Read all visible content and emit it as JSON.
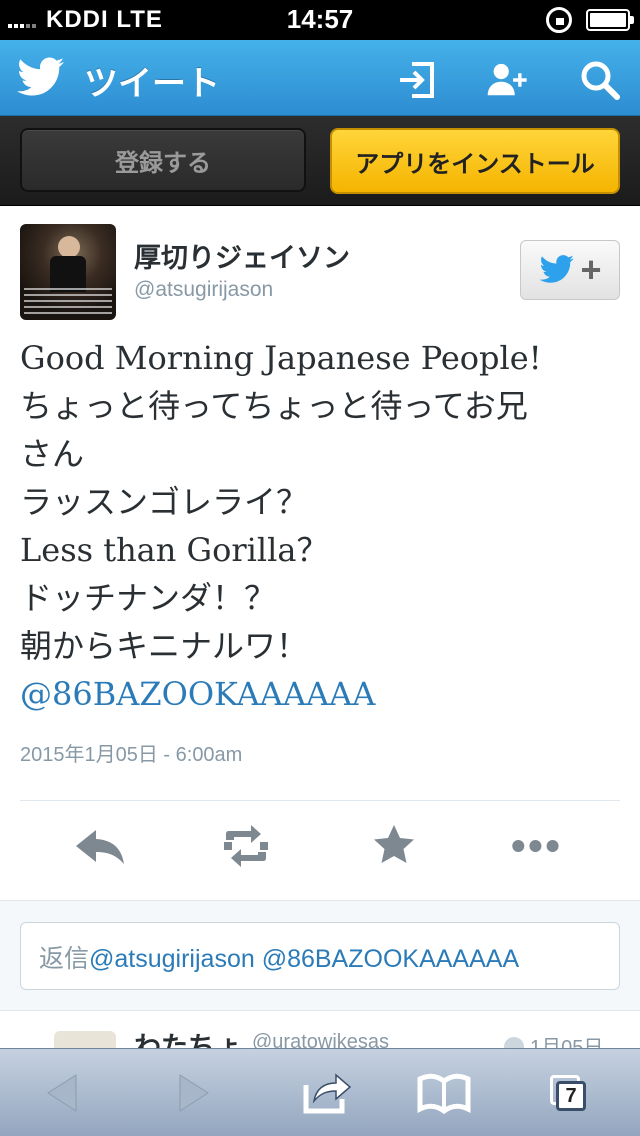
{
  "status_bar": {
    "carrier": "KDDI  LTE",
    "time": "14:57"
  },
  "header": {
    "title": "ツイート",
    "icons": [
      "twitter-bird-icon",
      "sign-in-icon",
      "add-user-icon",
      "search-icon"
    ]
  },
  "banner": {
    "signup_label": "登録する",
    "install_label": "アプリをインストール"
  },
  "tweet": {
    "display_name": "厚切りジェイソン",
    "username": "@atsugirijason",
    "lines": [
      "Good Morning Japanese People!",
      "ちょっと待ってちょっと待ってお兄",
      "さん",
      "ラッスンゴレライ？",
      "Less than Gorilla？",
      "ドッチナンダ！？",
      "朝からキニナルワ！"
    ],
    "mention": "@86BAZOOKAAAAAA",
    "timestamp": "2015年1月05日 - 6:00am"
  },
  "actions": [
    "reply-icon",
    "retweet-icon",
    "favorite-star-icon",
    "more-icon"
  ],
  "reply": {
    "prefix": "返信",
    "value": "@atsugirijason @86BAZOOKAAAAAA"
  },
  "next_tweet": {
    "display_name": "わたちょ",
    "username": "@uratowikesas",
    "date": "1月05日"
  },
  "safari": {
    "tabs_count": "7"
  },
  "colors": {
    "twitter_blue": "#2d8dd1",
    "install_yellow": "#f5b400",
    "link_blue": "#2b7bb9"
  }
}
